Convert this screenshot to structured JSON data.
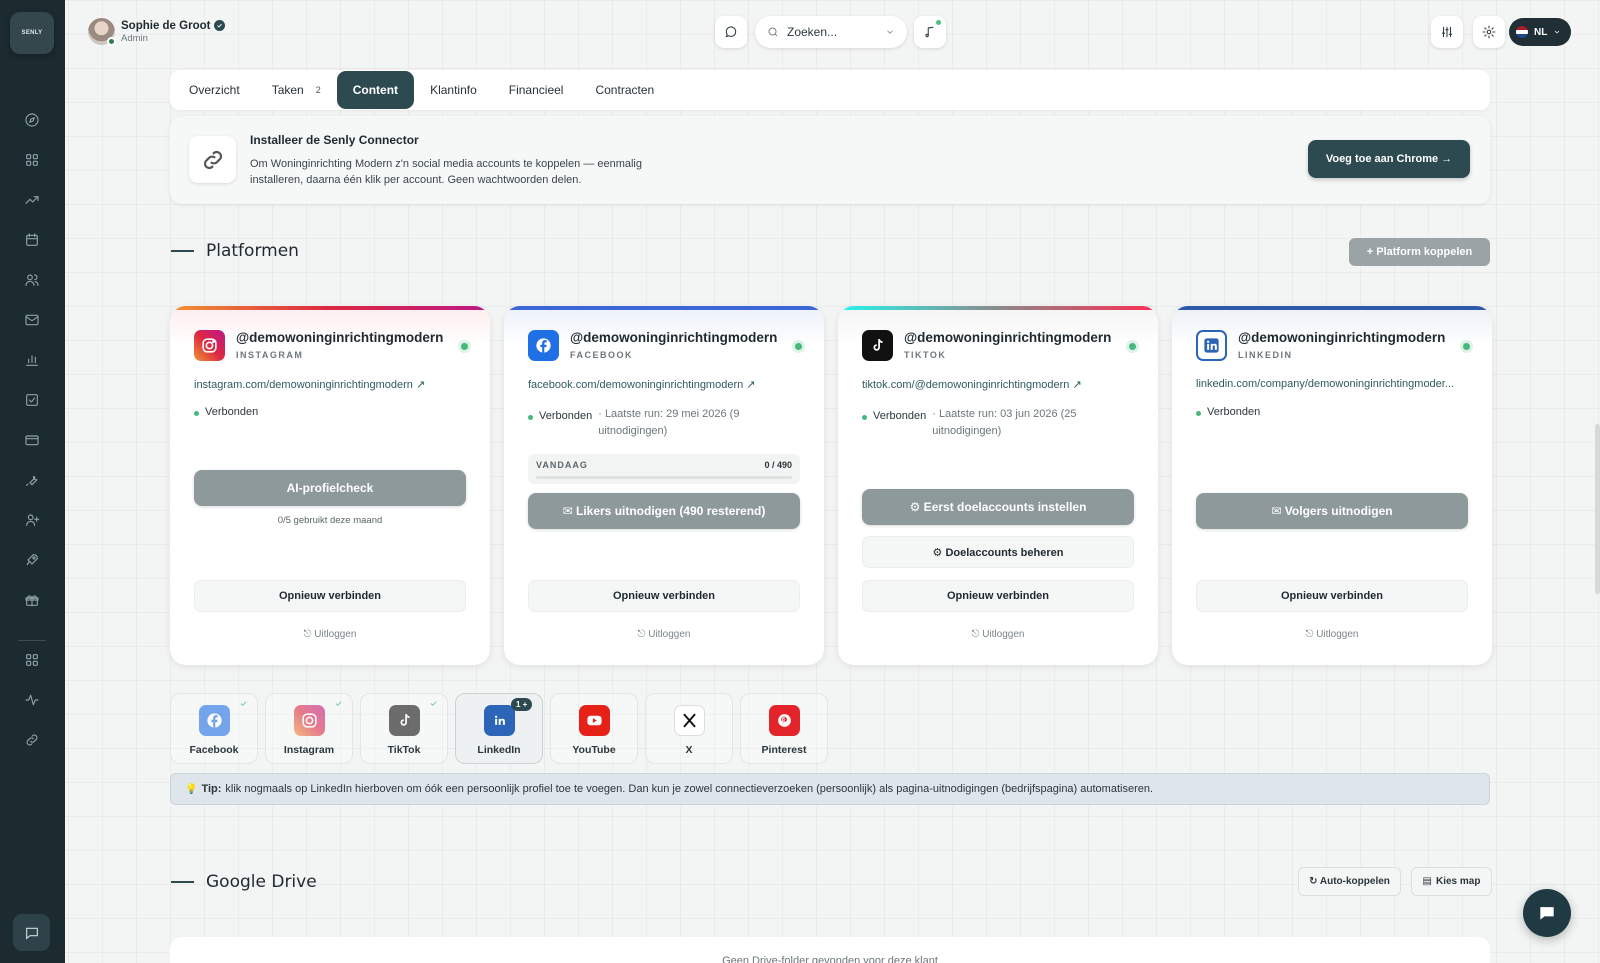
{
  "user": {
    "name": "Sophie de Groot",
    "role": "Admin"
  },
  "logo": {
    "text": "SENLY"
  },
  "sidebar": {
    "icons": [
      "compass-icon",
      "grid-icon",
      "trending-icon",
      "calendar-icon",
      "users-icon",
      "mail-icon",
      "bar-chart-icon",
      "checklist-icon",
      "card-icon",
      "wrench-icon",
      "user-plus-icon",
      "rocket-icon",
      "gift-icon",
      "apps-icon",
      "activity-icon",
      "link-icon"
    ]
  },
  "topbar": {
    "search_placeholder": "Zoeken...",
    "language": "NL"
  },
  "tabs": [
    {
      "label": "Overzicht",
      "badge": ""
    },
    {
      "label": "Taken",
      "badge": "2"
    },
    {
      "label": "Content",
      "badge": "",
      "active": true
    },
    {
      "label": "Klantinfo",
      "badge": ""
    },
    {
      "label": "Financieel",
      "badge": ""
    },
    {
      "label": "Contracten",
      "badge": ""
    }
  ],
  "connector": {
    "title": "Installeer de Senly Connector",
    "description": "Om Woninginrichting Modern z'n social media accounts te koppelen — eenmalig installeren, daarna één klik per account. Geen wachtwoorden delen.",
    "button": "Voeg toe aan Chrome →"
  },
  "platforms_section": {
    "title": "Platformen",
    "connect_button": "+ Platform koppelen"
  },
  "cards": [
    {
      "handle": "@demowoninginrichtingmodern",
      "platform": "INSTAGRAM",
      "link": "instagram.com/demowoninginrichtingmodern ↗",
      "status": "Verbonden",
      "last_run": "",
      "primary_button": "AI-profielcheck",
      "usage": "0/5 gebruikt deze maand",
      "reconnect": "Opnieuw verbinden",
      "logout": "⎋ Uitloggen"
    },
    {
      "handle": "@demowoninginrichtingmodern",
      "platform": "FACEBOOK",
      "link": "facebook.com/demowoninginrichtingmodern ↗",
      "status": "Verbonden",
      "last_run": "· Laatste run: 29 mei 2026 (9 uitnodigingen)",
      "today_label": "VANDAAG",
      "today_value": "0 / 490",
      "today_progress": 0,
      "primary_button": "✉ Likers uitnodigen (490 resterend)",
      "reconnect": "Opnieuw verbinden",
      "logout": "⎋ Uitloggen"
    },
    {
      "handle": "@demowoninginrichtingmodern",
      "platform": "TIKTOK",
      "link": "tiktok.com/@demowoninginrichtingmodern ↗",
      "status": "Verbonden",
      "last_run": "· Laatste run: 03 jun 2026 (25 uitnodigingen)",
      "primary_button": "⚙ Eerst doelaccounts instellen",
      "secondary_button": "⚙ Doelaccounts beheren",
      "reconnect": "Opnieuw verbinden",
      "logout": "⎋ Uitloggen"
    },
    {
      "handle": "@demowoninginrichtingmodern",
      "platform": "LINKEDIN",
      "link": "linkedin.com/company/demowoninginrichtingmoder...",
      "status": "Verbonden",
      "last_run": "",
      "primary_button": "✉ Volgers uitnodigen",
      "reconnect": "Opnieuw verbinden",
      "logout": "⎋ Uitloggen"
    }
  ],
  "picker": [
    {
      "name": "Facebook",
      "connected": true
    },
    {
      "name": "Instagram",
      "connected": true
    },
    {
      "name": "TikTok",
      "connected": true
    },
    {
      "name": "LinkedIn",
      "connected": false,
      "selected": true,
      "badge": "1 +"
    },
    {
      "name": "YouTube",
      "connected": false
    },
    {
      "name": "X",
      "connected": false
    },
    {
      "name": "Pinterest",
      "connected": false
    }
  ],
  "tip": {
    "label": "Tip:",
    "text": "klik nogmaals op LinkedIn hierboven om óók een persoonlijk profiel toe te voegen. Dan kun je zowel connectieverzoeken (persoonlijk) als pagina-uitnodigingen (bedrijfspagina) automatiseren."
  },
  "drive": {
    "title": "Google Drive",
    "auto_button": "↻ Auto-koppelen",
    "pick_button": "Kies map",
    "empty": "Geen Drive-folder gevonden voor deze klant"
  },
  "colors": {
    "sidebar": "#1c2b30",
    "accent": "#2e4a51",
    "online": "#47b87b"
  }
}
